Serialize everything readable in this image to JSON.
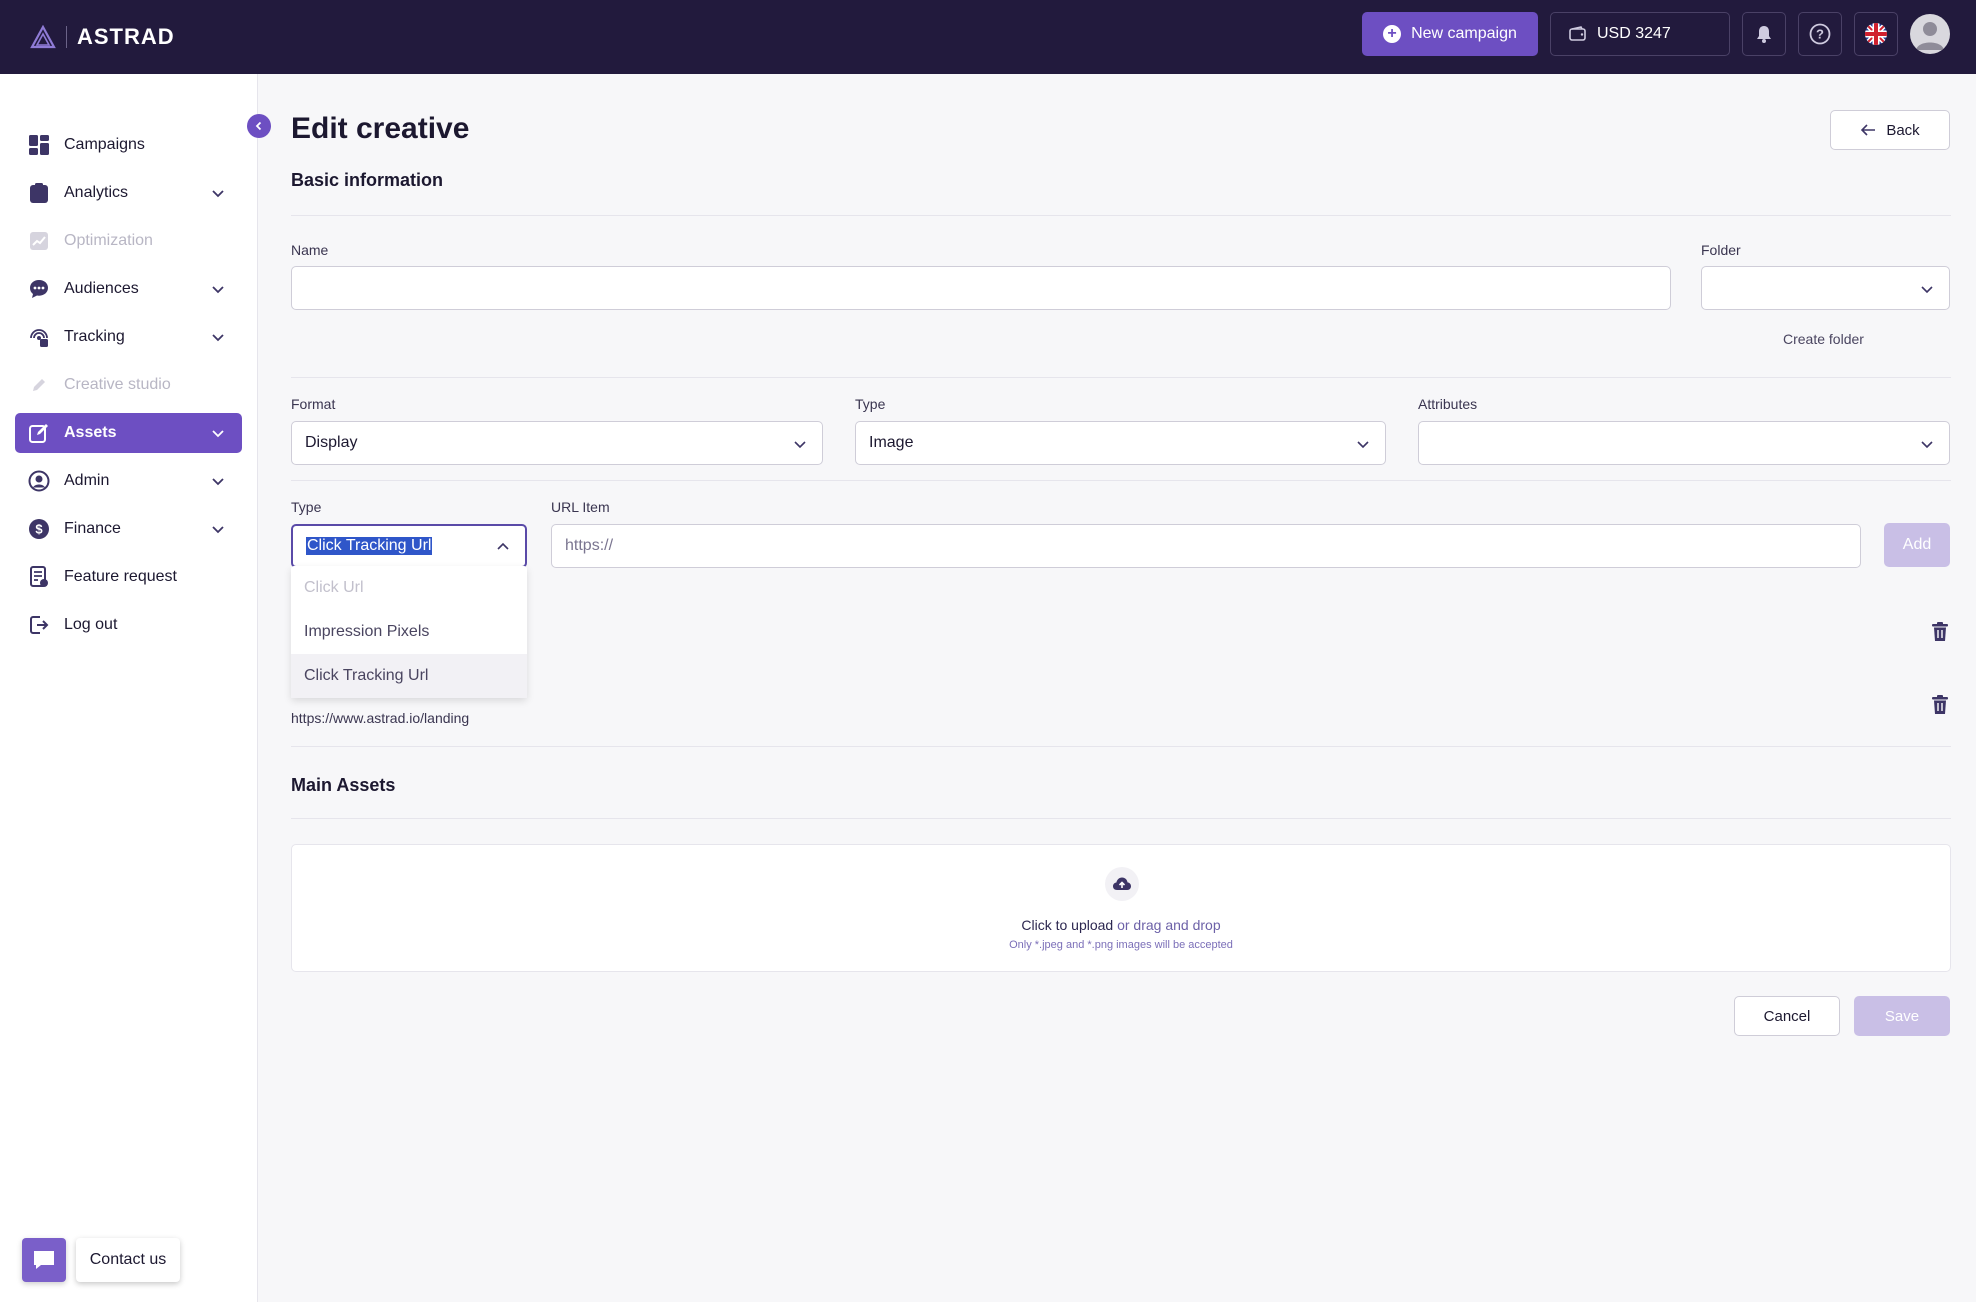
{
  "header": {
    "logo_text": "ASTRAD",
    "new_campaign_label": "New campaign",
    "balance": "USD 3247",
    "icons": [
      "bell-icon",
      "help-icon",
      "uk-flag-icon",
      "user-avatar-icon"
    ]
  },
  "sidebar": {
    "items": [
      {
        "label": "Campaigns",
        "icon": "dashboard-icon",
        "chevron": false,
        "state": "normal"
      },
      {
        "label": "Analytics",
        "icon": "clipboard-icon",
        "chevron": true,
        "state": "normal"
      },
      {
        "label": "Optimization",
        "icon": "chart-icon",
        "chevron": false,
        "state": "disabled"
      },
      {
        "label": "Audiences",
        "icon": "chat-bubble-icon",
        "chevron": true,
        "state": "normal"
      },
      {
        "label": "Tracking",
        "icon": "tracking-icon",
        "chevron": true,
        "state": "normal"
      },
      {
        "label": "Creative studio",
        "icon": "pencil-icon",
        "chevron": false,
        "state": "disabled"
      },
      {
        "label": "Assets",
        "icon": "edit-icon",
        "chevron": true,
        "state": "active"
      },
      {
        "label": "Admin",
        "icon": "user-circle-icon",
        "chevron": true,
        "state": "normal"
      },
      {
        "label": "Finance",
        "icon": "dollar-icon",
        "chevron": true,
        "state": "normal"
      },
      {
        "label": "Feature request",
        "icon": "request-icon",
        "chevron": false,
        "state": "normal"
      },
      {
        "label": "Log out",
        "icon": "logout-icon",
        "chevron": false,
        "state": "normal"
      }
    ]
  },
  "page": {
    "title": "Edit creative",
    "back_label": "Back"
  },
  "basic_info": {
    "section_title": "Basic information",
    "name_label": "Name",
    "name_value": "",
    "folder_label": "Folder",
    "folder_value": "",
    "create_folder_label": "Create folder",
    "format_label": "Format",
    "format_value": "Display",
    "type_label": "Type",
    "type_value": "Image",
    "attributes_label": "Attributes",
    "attributes_value": ""
  },
  "url_row": {
    "type_label": "Type",
    "type_value": "Click Tracking Url",
    "url_label": "URL Item",
    "url_placeholder": "https://",
    "add_label": "Add",
    "dropdown_options": [
      {
        "label": "Click Url",
        "state": "disabled"
      },
      {
        "label": "Impression Pixels",
        "state": "normal"
      },
      {
        "label": "Click Tracking Url",
        "state": "highlighted"
      }
    ],
    "existing_url": "https://www.astrad.io/landing"
  },
  "main_assets": {
    "section_title": "Main Assets",
    "upload_cta": "Click to upload",
    "upload_rest": " or drag and drop",
    "upload_hint": "Only *.jpeg and *.png images will be accepted"
  },
  "footer": {
    "cancel_label": "Cancel",
    "save_label": "Save",
    "contact_label": "Contact us"
  },
  "colors": {
    "header_bg": "#221a3d",
    "accent": "#6d4fc2",
    "accent_disabled": "#c9bfe6",
    "selection": "#2f56c9"
  }
}
